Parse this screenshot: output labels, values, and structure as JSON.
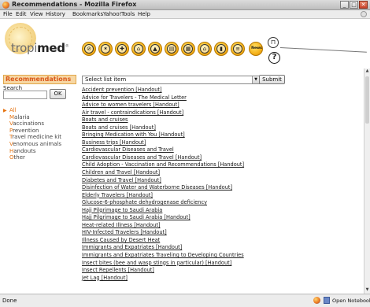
{
  "window": {
    "title": "Recommendations - Mozilla Firefox",
    "minimize": "_",
    "maximize": "□",
    "close": "✕"
  },
  "menubar": [
    "File",
    "Edit",
    "View",
    "History",
    "Bookmarks",
    "Yahoo!",
    "Tools",
    "Help"
  ],
  "logo": {
    "prefix": "tropi",
    "suffix": "med",
    "mark": "®"
  },
  "toolbar_icons": [
    {
      "name": "no-entry-icon",
      "glyph": "⊘"
    },
    {
      "name": "insect-icon",
      "glyph": "✶"
    },
    {
      "name": "first-aid-icon",
      "glyph": "✚"
    },
    {
      "name": "clinic-icon",
      "glyph": "⌂"
    },
    {
      "name": "mountain-icon",
      "glyph": "▲"
    },
    {
      "name": "document-icon",
      "glyph": "▤"
    },
    {
      "name": "map-icon",
      "glyph": "▦"
    },
    {
      "name": "house-icon",
      "glyph": "⌂"
    },
    {
      "name": "phone-icon",
      "glyph": "▮"
    },
    {
      "name": "notes-icon",
      "glyph": "≡"
    }
  ],
  "toolbar_news": "News",
  "toolbar_lock": "⊓",
  "toolbar_help": "?",
  "sidebar": {
    "heading": "Recommendations",
    "search_label": "Search",
    "ok_label": "OK",
    "categories": [
      {
        "first": "A",
        "rest": "ll",
        "active": true
      },
      {
        "first": "M",
        "rest": "alaria",
        "active": false
      },
      {
        "first": "V",
        "rest": "accinations",
        "active": false
      },
      {
        "first": "P",
        "rest": "revention",
        "active": false
      },
      {
        "first": "T",
        "rest": "ravel medicine kit",
        "active": false
      },
      {
        "first": "V",
        "rest": "enomous animals",
        "active": false
      },
      {
        "first": "H",
        "rest": "andouts",
        "active": false
      },
      {
        "first": "O",
        "rest": "ther",
        "active": false
      }
    ]
  },
  "main": {
    "select_value": "Select list item",
    "submit_label": "Submit",
    "links": [
      "Accident prevention [Handout]",
      "Advice for Travelers - The Medical Letter",
      "Advice to women travelers [Handout]",
      "Air travel - contraindications [Handout]",
      "Boats and cruises",
      "Boats and cruises [Handout]",
      "Bringing Medication with You [Handout]",
      "Business trips [Handout]",
      "Cardiovascular Diseases and Travel",
      "Cardiovascular Diseases and Travel [Handout]",
      "Child Adoption - Vaccination and Recommendations [Handout]",
      "Children and Travel [Handout]",
      "Diabetes and Travel [Handout]",
      "Disinfection of Water and Waterborne Diseases [Handout]",
      "Elderly Travelers [Handout]",
      "Glucose-6-phosphate dehydrogenase deficiency",
      "Hajj Pilgrimage to Saudi Arabia",
      "Hajj Pilgrimage to Saudi Arabia [Handout]",
      "Heat-related Illness [Handout]",
      "HIV-Infected Travelers [Handout]",
      "Illness Caused by Desert Heat",
      "Immigrants and Expatriates [Handout]",
      "Immigrants and Expatriates Traveling to Developing Countries",
      "Insect bites (bee and wasp stings in particular) [Handout]",
      "Insect Repellents [Handout]",
      "Jet Lag [Handout]"
    ]
  },
  "scrollbar": {
    "up": "▲",
    "down": "▼"
  },
  "status": {
    "text": "Done",
    "notebook": "Open Notebook"
  },
  "colors": {
    "accent": "#e5720f",
    "sidebar_heading_bg": "#f7d7a3",
    "toolbar_icon": "#f5b31c"
  }
}
